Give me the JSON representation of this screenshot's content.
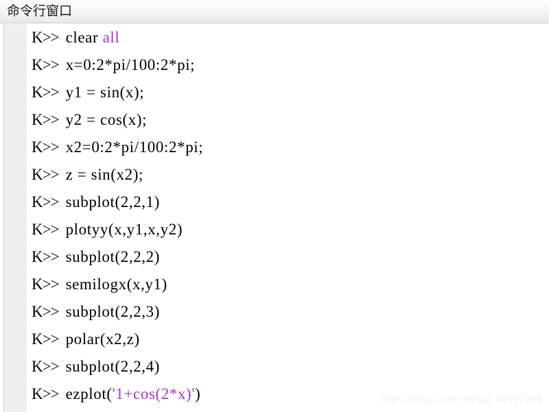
{
  "window": {
    "title": "命令行窗口"
  },
  "console": {
    "prompt": "K>>",
    "lines": [
      {
        "prompt": "K>>",
        "segments": [
          {
            "text": "clear ",
            "type": "plain"
          },
          {
            "text": "all",
            "type": "keyword"
          }
        ]
      },
      {
        "prompt": "K>>",
        "segments": [
          {
            "text": "x=0:2*pi/100:2*pi;",
            "type": "plain"
          }
        ]
      },
      {
        "prompt": "K>>",
        "segments": [
          {
            "text": "y1 = sin(x);",
            "type": "plain"
          }
        ]
      },
      {
        "prompt": "K>>",
        "segments": [
          {
            "text": "y2 = cos(x);",
            "type": "plain"
          }
        ]
      },
      {
        "prompt": "K>>",
        "segments": [
          {
            "text": "x2=0:2*pi/100:2*pi;",
            "type": "plain"
          }
        ]
      },
      {
        "prompt": "K>>",
        "segments": [
          {
            "text": "z = sin(x2);",
            "type": "plain"
          }
        ]
      },
      {
        "prompt": "K>>",
        "segments": [
          {
            "text": "subplot(2,2,1)",
            "type": "plain"
          }
        ]
      },
      {
        "prompt": "K>>",
        "segments": [
          {
            "text": "plotyy(x,y1,x,y2)",
            "type": "plain"
          }
        ]
      },
      {
        "prompt": "K>>",
        "segments": [
          {
            "text": "subplot(2,2,2)",
            "type": "plain"
          }
        ]
      },
      {
        "prompt": "K>>",
        "segments": [
          {
            "text": "semilogx(x,y1)",
            "type": "plain"
          }
        ]
      },
      {
        "prompt": "K>>",
        "segments": [
          {
            "text": "subplot(2,2,3)",
            "type": "plain"
          }
        ]
      },
      {
        "prompt": "K>>",
        "segments": [
          {
            "text": "polar(x2,z)",
            "type": "plain"
          }
        ]
      },
      {
        "prompt": "K>>",
        "segments": [
          {
            "text": "subplot(2,2,4)",
            "type": "plain"
          }
        ]
      },
      {
        "prompt": "K>>",
        "segments": [
          {
            "text": "ezplot(",
            "type": "plain"
          },
          {
            "text": "'1+cos(2*x)'",
            "type": "string"
          },
          {
            "text": ")",
            "type": "plain"
          }
        ]
      }
    ]
  },
  "watermark": {
    "text": "https://blog.csdn.net/qq_44957388"
  },
  "colors": {
    "keyword": "#a933cc",
    "string": "#a933cc",
    "text": "#000000",
    "titlebar_bg": "#e9e9e9",
    "gutter_bg": "#efefef",
    "console_bg": "#ffffff",
    "watermark": "#f0f0f0"
  }
}
